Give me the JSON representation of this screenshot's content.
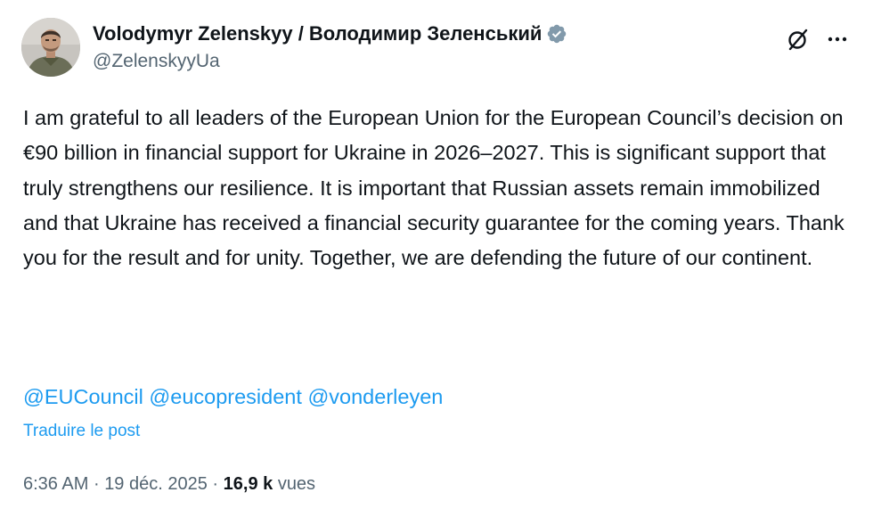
{
  "author": {
    "display_name": "Volodymyr Zelenskyy / Володимир Зеленський",
    "handle": "@ZelenskyyUa",
    "verified": true
  },
  "body": {
    "text": "I am grateful to all leaders of the European Union for the European Council’s decision on €90 billion in financial support for Ukraine in 2026–2027. This is significant support that truly strengthens our resilience. It is important that Russian assets remain immobilized and that Ukraine has received a financial security guarantee for the coming years. Thank you for the result and for unity. Together, we are defending the future of our continent."
  },
  "mentions": [
    "@EUCouncil",
    "@eucopresident",
    "@vonderleyen"
  ],
  "translate_label": "Traduire le post",
  "meta": {
    "time": "6:36 AM",
    "separator": "·",
    "date": "19 déc. 2025",
    "views_count": "16,9 k",
    "views_label": "vues"
  },
  "colors": {
    "accent": "#1d9bf0",
    "text_primary": "#0f1419",
    "text_secondary": "#536471",
    "verified_badge": "#829aab"
  },
  "icons": {
    "grok": "grok-icon",
    "more": "more-options-icon",
    "verified": "verified-badge-icon"
  }
}
